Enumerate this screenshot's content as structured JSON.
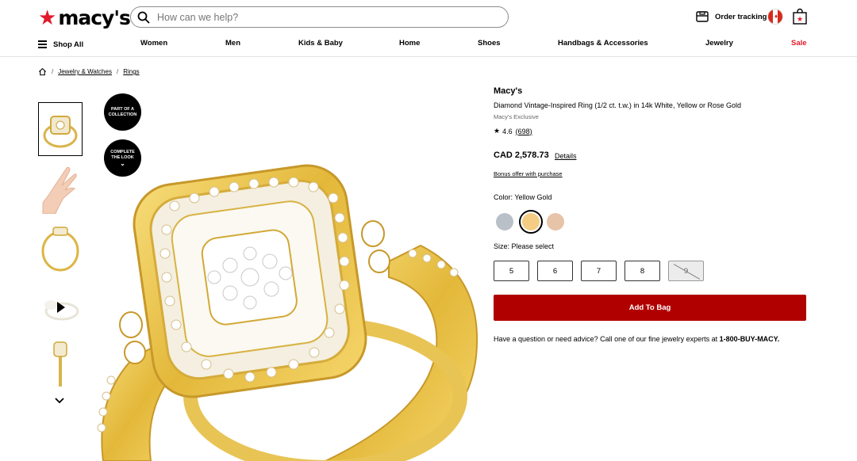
{
  "header": {
    "logo_text": "macy's",
    "search": {
      "placeholder": "How can we help?"
    },
    "order_tracking": "Order tracking",
    "icons": {
      "search": "search-icon",
      "order": "truck-icon",
      "flag": "canada-flag-icon",
      "bag": "shopping-bag-icon"
    }
  },
  "nav": {
    "items": [
      "Shop All",
      "Women",
      "Men",
      "Kids & Baby",
      "Home",
      "Shoes",
      "Handbags & Accessories",
      "Jewelry",
      "Sale"
    ],
    "sale_color": "#e11a2b"
  },
  "breadcrumb": [
    "Jewelry & Watches",
    "Rings"
  ],
  "gallery": {
    "badges": [
      {
        "line1": "PART OF A",
        "line2": "COLLECTION"
      },
      {
        "line1": "COMPLETE",
        "line2": "THE LOOK"
      }
    ]
  },
  "product": {
    "brand": "Macy's",
    "name": "Diamond Vintage-Inspired Ring (1/2 ct. t.w.) in 14k White, Yellow or Rose Gold",
    "exclusive": "Macy's Exclusive",
    "rating": "4.6",
    "review_count": "(698)",
    "price": "CAD 2,578.73",
    "details_link": "Details",
    "bonus": "Bonus offer with purchase",
    "color_label": "Color: Yellow Gold",
    "colors": [
      {
        "name": "White Gold",
        "hex": "#b9c0c8"
      },
      {
        "name": "Yellow Gold",
        "hex": "#f4cc84",
        "selected": true
      },
      {
        "name": "Rose Gold",
        "hex": "#e7c3a8"
      }
    ],
    "size_label": "Size: Please select",
    "sizes": [
      "5",
      "6",
      "7",
      "8",
      "9"
    ],
    "add_to_bag": "Add To Bag",
    "help_text": "Have a question or need advice? Call one of our fine jewelry experts at ",
    "help_phone": "1-800-BUY-MACY."
  },
  "colors": {
    "accent_red": "#b00000",
    "brand_red": "#e11a2b"
  }
}
